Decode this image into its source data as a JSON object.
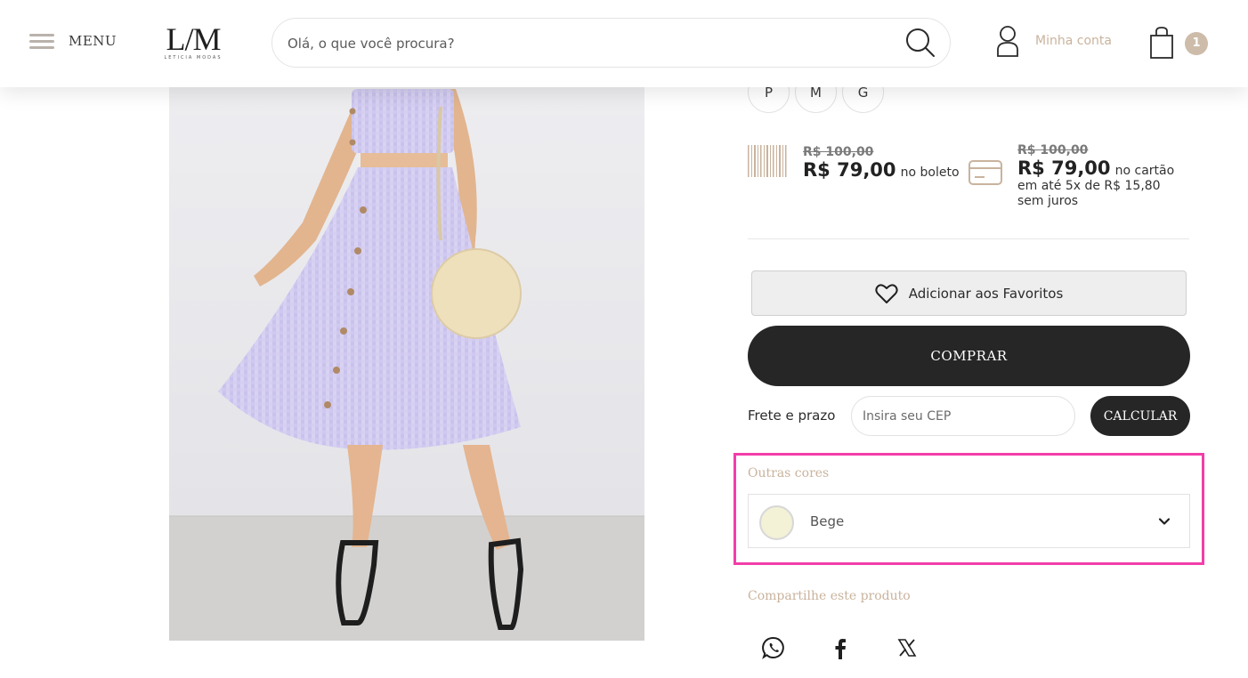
{
  "header": {
    "menu_label": "MENU",
    "logo_mark": "L/M",
    "logo_sub": "LETICIA MODAS",
    "search_placeholder": "Olá, o que você procura?",
    "account_label": "Minha conta",
    "cart_count": "1"
  },
  "product": {
    "image_alt": "Conjunto saia midi e cropped lilás xadrez",
    "sizes": [
      "P",
      "M",
      "G"
    ],
    "price_boleto": {
      "old": "R$ 100,00",
      "new": "R$ 79,00",
      "note": "no boleto"
    },
    "price_cartao": {
      "old": "R$ 100,00",
      "new": "R$ 79,00",
      "note": "no cartão",
      "installments_line1": "em até 5x de R$ 15,80",
      "installments_line2": "sem juros"
    },
    "favorite_label": "Adicionar aos Favoritos",
    "buy_label": "COMPRAR",
    "shipping": {
      "label": "Frete e prazo",
      "cep_placeholder": "Insira seu CEP",
      "calc_label": "CALCULAR"
    },
    "other_colors": {
      "title": "Outras cores",
      "selected": "Bege",
      "swatch_color": "#f3f1d6"
    },
    "share": {
      "title": "Compartilhe este produto",
      "networks": [
        "whatsapp-icon",
        "facebook-icon",
        "x-icon"
      ]
    }
  },
  "colors": {
    "accent_beige": "#c9b39d",
    "dark_button": "#262626",
    "highlight": "#f23ea9",
    "badge": "#cdbcaa"
  }
}
